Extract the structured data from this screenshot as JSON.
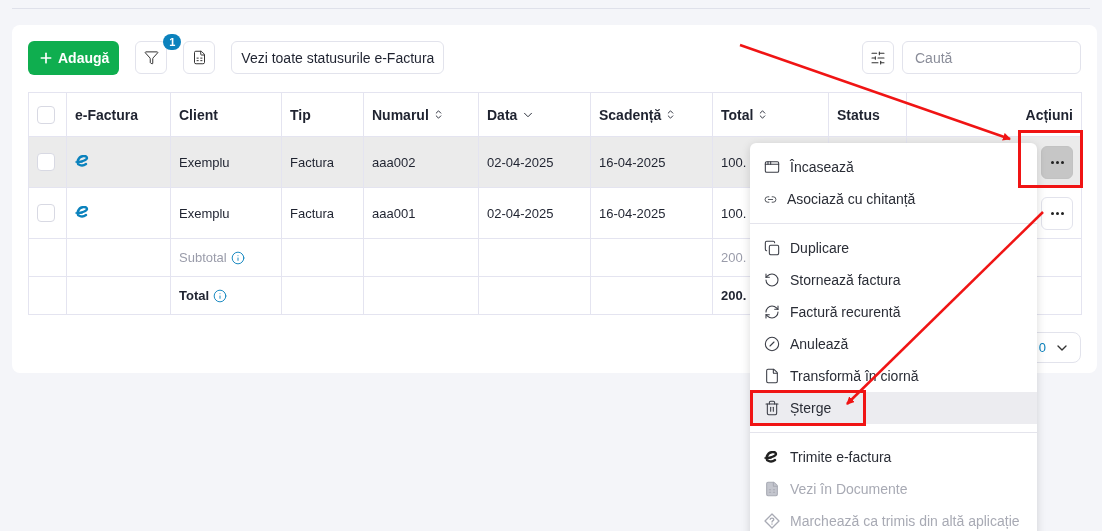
{
  "toolbar": {
    "add_button": "Adaugă",
    "filter_badge": "1",
    "status_button": "Vezi toate statusurile e-Factura",
    "search": {
      "placeholder": "Caută"
    }
  },
  "table": {
    "select_all": {
      "checked": false
    },
    "columns": [
      {
        "label": "e-Factura",
        "kind": "text"
      },
      {
        "label": "Client",
        "kind": "text"
      },
      {
        "label": "Tip",
        "kind": "text"
      },
      {
        "label": "Numarul",
        "kind": "sortable",
        "sorted": false
      },
      {
        "label": "Data",
        "kind": "sortable",
        "sorted": true
      },
      {
        "label": "Scadență",
        "kind": "sortable",
        "sorted": false
      },
      {
        "label": "Total",
        "kind": "sortable",
        "sorted": false
      },
      {
        "label": "Status",
        "kind": "text"
      },
      {
        "label": "Acțiuni",
        "kind": "actions"
      }
    ],
    "rows": [
      {
        "checked": false,
        "highlighted": true,
        "client": "Exemplu",
        "tip": "Factura",
        "numarul": "aaa002",
        "data": "02-04-2025",
        "scadenta": "16-04-2025",
        "total": "100.",
        "menu_open": true
      },
      {
        "checked": false,
        "highlighted": false,
        "client": "Exemplu",
        "tip": "Factura",
        "numarul": "aaa001",
        "data": "02-04-2025",
        "scadenta": "16-04-2025",
        "total": "100.",
        "menu_open": false
      }
    ],
    "summary": [
      {
        "kind": "subtotal",
        "label": "Subtotal",
        "total": "200."
      },
      {
        "kind": "total",
        "label": "Total",
        "total": "200."
      }
    ]
  },
  "pagination": {
    "page_size": "0"
  },
  "menu": {
    "sections": [
      [
        {
          "label": "Încasează",
          "disabled": false,
          "selected": false
        },
        {
          "label": "Asociază cu chitanță",
          "disabled": false,
          "selected": false
        }
      ],
      [
        {
          "label": "Duplicare",
          "disabled": false,
          "selected": false
        },
        {
          "label": "Stornează factura",
          "disabled": false,
          "selected": false
        },
        {
          "label": "Factură recurentă",
          "disabled": false,
          "selected": false
        },
        {
          "label": "Anulează",
          "disabled": false,
          "selected": false
        },
        {
          "label": "Transformă în ciornă",
          "disabled": false,
          "selected": false
        },
        {
          "label": "Șterge",
          "disabled": false,
          "selected": true
        }
      ],
      [
        {
          "label": "Trimite e-factura",
          "disabled": false,
          "selected": false
        },
        {
          "label": "Vezi în Documente",
          "disabled": true,
          "selected": false
        },
        {
          "label": "Marchează ca trimis din altă aplicație",
          "disabled": true,
          "selected": false
        }
      ]
    ]
  }
}
